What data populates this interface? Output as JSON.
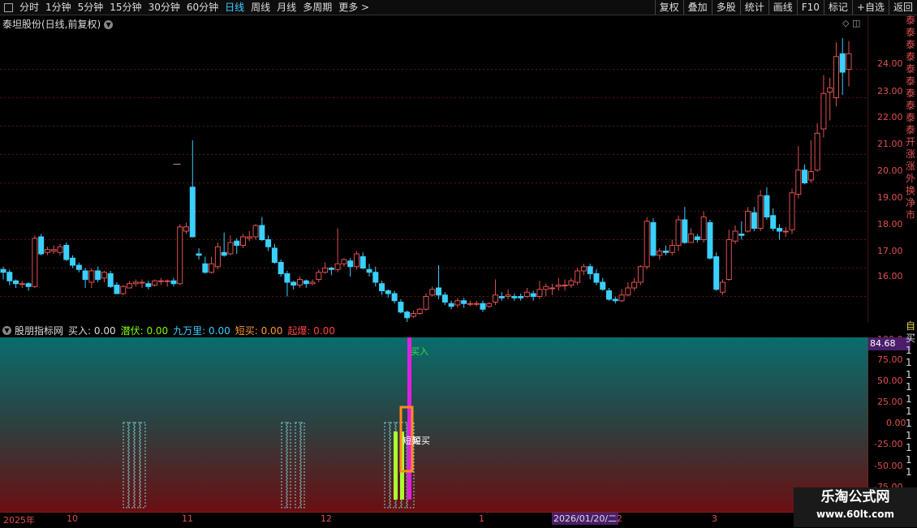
{
  "toolbar": {
    "periods": [
      "分时",
      "1分钟",
      "5分钟",
      "15分钟",
      "30分钟",
      "60分钟",
      "日线",
      "周线",
      "月线",
      "多周期",
      "更多 >"
    ],
    "active_period": "日线",
    "actions": [
      "复权",
      "叠加",
      "多股",
      "统计",
      "画线",
      "F10",
      "标记",
      "+自选",
      "返回"
    ]
  },
  "main_chart": {
    "title": "泰坦股份(日线,前复权)",
    "price_axis": [
      "24.00",
      "23.00",
      "22.00",
      "21.00",
      "20.00",
      "19.00",
      "18.00",
      "17.00",
      "16.00"
    ],
    "left_mark": "—"
  },
  "indicator": {
    "name": "股朋指标网",
    "values": [
      {
        "label": "买入: 0.00",
        "color": "#dddddd"
      },
      {
        "label": "潜伏: 0.00",
        "color": "#7CFC00"
      },
      {
        "label": "九万里: 0.00",
        "color": "#3ad0ff"
      },
      {
        "label": "短买: 0.00",
        "color": "#ff9933"
      },
      {
        "label": "起爆: 0.00",
        "color": "#ff4444"
      }
    ],
    "axis": [
      "100.0",
      "75.00",
      "50.00",
      "25.00",
      "0.00",
      "-25.00",
      "-50.00",
      "-75.00"
    ],
    "current_value": "84.68",
    "buy_label": "买入",
    "short_buy_label": "短买",
    "short_buy_label2": "短买"
  },
  "dates": {
    "labels": [
      "2025年",
      "10",
      "11",
      "12",
      "1",
      "2",
      "3"
    ],
    "highlight": "2026/01/20/二"
  },
  "right_strip": [
    "泰",
    "泰",
    "泰",
    "泰",
    "泰",
    "泰",
    "泰",
    "泰",
    "泰",
    "泰",
    "开",
    "涨",
    "涨",
    "外",
    "换",
    "净",
    "市"
  ],
  "right_strip_ind": [
    "自",
    "买",
    "1",
    "1",
    "1",
    "1",
    "1",
    "1",
    "1",
    "1",
    "1",
    "1",
    "1"
  ],
  "watermark": {
    "title": "乐淘公式网",
    "url": "www.60lt.com"
  },
  "chart_data": {
    "type": "candlestick",
    "up_color": "#e05050",
    "down_color": "#3ad0ff",
    "ylim": [
      15.1,
      25.9
    ],
    "candles": [
      [
        16.95,
        16.85,
        17.05,
        16.6
      ],
      [
        16.85,
        16.55,
        16.95,
        16.4
      ],
      [
        16.55,
        16.45,
        16.6,
        16.3
      ],
      [
        16.45,
        16.45,
        16.55,
        16.3
      ],
      [
        16.45,
        16.35,
        16.5,
        16.2
      ],
      [
        16.35,
        18.05,
        18.15,
        16.3
      ],
      [
        18.1,
        17.5,
        18.2,
        17.45
      ],
      [
        17.55,
        17.65,
        17.75,
        17.45
      ],
      [
        17.6,
        17.65,
        17.8,
        17.5
      ],
      [
        17.55,
        17.75,
        17.85,
        17.45
      ],
      [
        17.8,
        17.3,
        17.9,
        17.25
      ],
      [
        17.35,
        17.1,
        17.45,
        17.0
      ],
      [
        17.1,
        16.95,
        17.2,
        16.85
      ],
      [
        16.9,
        16.6,
        17.0,
        16.3
      ],
      [
        16.5,
        16.9,
        17.0,
        16.3
      ],
      [
        16.9,
        16.6,
        17.05,
        16.5
      ],
      [
        16.65,
        16.85,
        16.9,
        16.5
      ],
      [
        16.8,
        16.35,
        16.9,
        16.3
      ],
      [
        16.4,
        16.1,
        16.5,
        16.1
      ],
      [
        16.1,
        16.35,
        16.4,
        16.05
      ],
      [
        16.3,
        16.45,
        16.55,
        16.3
      ],
      [
        16.45,
        16.5,
        16.6,
        16.35
      ],
      [
        16.5,
        16.5,
        16.6,
        16.3
      ],
      [
        16.45,
        16.35,
        16.55,
        16.25
      ],
      [
        16.4,
        16.55,
        16.6,
        16.35
      ],
      [
        16.55,
        16.55,
        16.65,
        16.4
      ],
      [
        16.55,
        16.55,
        16.6,
        16.35
      ],
      [
        16.55,
        16.45,
        16.65,
        16.35
      ],
      [
        16.45,
        18.45,
        18.55,
        16.4
      ],
      [
        18.3,
        18.45,
        18.6,
        18.2
      ],
      [
        19.85,
        18.1,
        21.5,
        18.1
      ],
      [
        17.5,
        17.45,
        17.7,
        17.3
      ],
      [
        17.15,
        16.85,
        17.4,
        16.8
      ],
      [
        16.85,
        17.15,
        17.4,
        16.8
      ],
      [
        17.05,
        17.75,
        17.9,
        16.95
      ],
      [
        17.55,
        17.45,
        18.25,
        17.4
      ],
      [
        17.5,
        17.9,
        18.15,
        17.45
      ],
      [
        17.95,
        17.8,
        18.05,
        17.5
      ],
      [
        17.8,
        18.1,
        18.2,
        17.7
      ],
      [
        18.05,
        18.1,
        18.3,
        17.95
      ],
      [
        18.1,
        18.5,
        18.55,
        18.0
      ],
      [
        18.5,
        18.0,
        18.8,
        17.95
      ],
      [
        18.0,
        17.75,
        18.15,
        17.6
      ],
      [
        17.7,
        17.2,
        17.85,
        17.15
      ],
      [
        17.2,
        16.8,
        17.3,
        16.7
      ],
      [
        16.8,
        16.5,
        16.9,
        16.0
      ],
      [
        16.5,
        16.4,
        16.55,
        16.25
      ],
      [
        16.4,
        16.6,
        16.7,
        16.3
      ],
      [
        16.55,
        16.45,
        16.6,
        16.3
      ],
      [
        16.45,
        16.5,
        16.6,
        16.4
      ],
      [
        16.6,
        16.85,
        16.95,
        16.5
      ],
      [
        16.85,
        17.0,
        17.2,
        16.8
      ],
      [
        17.0,
        16.95,
        17.05,
        16.75
      ],
      [
        16.95,
        17.15,
        18.4,
        16.85
      ],
      [
        17.15,
        17.3,
        17.35,
        17.05
      ],
      [
        17.25,
        17.05,
        17.35,
        16.7
      ],
      [
        17.05,
        17.5,
        17.6,
        16.95
      ],
      [
        17.4,
        17.0,
        17.55,
        16.95
      ],
      [
        16.95,
        16.85,
        17.15,
        16.7
      ],
      [
        16.85,
        16.5,
        17.05,
        16.35
      ],
      [
        16.45,
        16.2,
        16.55,
        16.05
      ],
      [
        16.2,
        16.1,
        16.25,
        15.95
      ],
      [
        16.1,
        15.85,
        16.2,
        15.75
      ],
      [
        15.8,
        15.45,
        15.9,
        15.4
      ],
      [
        15.45,
        15.25,
        15.5,
        15.1
      ],
      [
        15.3,
        15.4,
        15.5,
        15.25
      ],
      [
        15.4,
        15.55,
        15.6,
        15.35
      ],
      [
        15.55,
        16.0,
        16.1,
        15.5
      ],
      [
        16.05,
        16.25,
        16.35,
        16.0
      ],
      [
        16.3,
        16.05,
        17.1,
        15.9
      ],
      [
        16.05,
        15.8,
        16.15,
        15.7
      ],
      [
        15.75,
        15.65,
        15.85,
        15.55
      ],
      [
        15.7,
        15.85,
        15.95,
        15.6
      ],
      [
        15.85,
        15.75,
        15.95,
        15.6
      ],
      [
        15.75,
        15.75,
        15.85,
        15.65
      ],
      [
        15.75,
        15.75,
        15.85,
        15.65
      ],
      [
        15.75,
        15.55,
        15.85,
        15.45
      ],
      [
        15.65,
        15.75,
        15.8,
        15.6
      ],
      [
        15.8,
        16.05,
        16.6,
        15.7
      ],
      [
        16.0,
        15.95,
        16.15,
        15.85
      ],
      [
        16.0,
        16.05,
        16.25,
        15.9
      ],
      [
        16.0,
        15.95,
        16.1,
        15.85
      ],
      [
        16.0,
        15.95,
        16.1,
        15.85
      ],
      [
        16.0,
        16.15,
        16.3,
        15.95
      ],
      [
        16.1,
        16.0,
        16.2,
        15.85
      ],
      [
        16.0,
        16.25,
        16.55,
        15.9
      ],
      [
        16.25,
        16.35,
        16.45,
        16.0
      ],
      [
        16.3,
        16.3,
        16.45,
        16.05
      ],
      [
        16.35,
        16.4,
        16.65,
        16.2
      ],
      [
        16.4,
        16.4,
        16.6,
        16.2
      ],
      [
        16.4,
        16.55,
        16.65,
        16.3
      ],
      [
        16.5,
        16.9,
        17.0,
        16.4
      ],
      [
        16.9,
        17.05,
        17.15,
        16.75
      ],
      [
        17.05,
        16.8,
        17.15,
        16.6
      ],
      [
        16.8,
        16.5,
        16.95,
        16.4
      ],
      [
        16.5,
        16.25,
        16.65,
        16.2
      ],
      [
        16.2,
        15.9,
        16.3,
        15.85
      ],
      [
        15.9,
        15.85,
        16.0,
        15.75
      ],
      [
        15.85,
        16.05,
        16.25,
        15.8
      ],
      [
        16.05,
        16.3,
        16.5,
        16.0
      ],
      [
        16.3,
        16.5,
        16.65,
        16.2
      ],
      [
        16.5,
        17.05,
        17.1,
        16.4
      ],
      [
        17.05,
        18.65,
        18.8,
        16.95
      ],
      [
        18.6,
        17.45,
        18.75,
        17.4
      ],
      [
        17.45,
        17.6,
        17.7,
        17.3
      ],
      [
        17.6,
        17.55,
        17.8,
        17.45
      ],
      [
        17.55,
        17.8,
        18.0,
        17.45
      ],
      [
        17.8,
        18.7,
        18.85,
        17.6
      ],
      [
        18.7,
        17.9,
        19.15,
        17.85
      ],
      [
        17.9,
        18.2,
        18.4,
        17.9
      ],
      [
        18.1,
        18.0,
        18.2,
        17.9
      ],
      [
        18.0,
        18.8,
        19.0,
        17.9
      ],
      [
        18.6,
        17.35,
        18.7,
        17.3
      ],
      [
        17.4,
        16.25,
        17.55,
        16.2
      ],
      [
        16.15,
        16.5,
        16.6,
        16.05
      ],
      [
        16.6,
        18.0,
        18.35,
        16.55
      ],
      [
        17.95,
        18.3,
        18.5,
        17.85
      ],
      [
        18.2,
        18.15,
        18.65,
        18.0
      ],
      [
        18.3,
        19.0,
        19.15,
        18.25
      ],
      [
        18.95,
        18.4,
        19.15,
        18.3
      ],
      [
        18.4,
        19.55,
        19.75,
        18.3
      ],
      [
        19.55,
        18.8,
        19.85,
        18.7
      ],
      [
        18.85,
        18.4,
        19.1,
        18.3
      ],
      [
        18.4,
        18.3,
        18.55,
        18.0
      ],
      [
        18.3,
        18.3,
        18.45,
        18.1
      ],
      [
        18.35,
        19.65,
        19.8,
        18.2
      ],
      [
        19.6,
        20.45,
        21.3,
        19.45
      ],
      [
        20.45,
        20.0,
        20.65,
        19.95
      ],
      [
        20.1,
        20.4,
        21.5,
        20.0
      ],
      [
        20.45,
        21.75,
        22.1,
        20.4
      ],
      [
        21.9,
        23.15,
        23.8,
        21.6
      ],
      [
        23.2,
        23.35,
        23.7,
        22.2
      ],
      [
        23.0,
        24.45,
        24.95,
        22.7
      ],
      [
        24.55,
        23.9,
        25.1,
        23.1
      ],
      [
        24.0,
        24.55,
        25.0,
        23.4
      ]
    ]
  }
}
